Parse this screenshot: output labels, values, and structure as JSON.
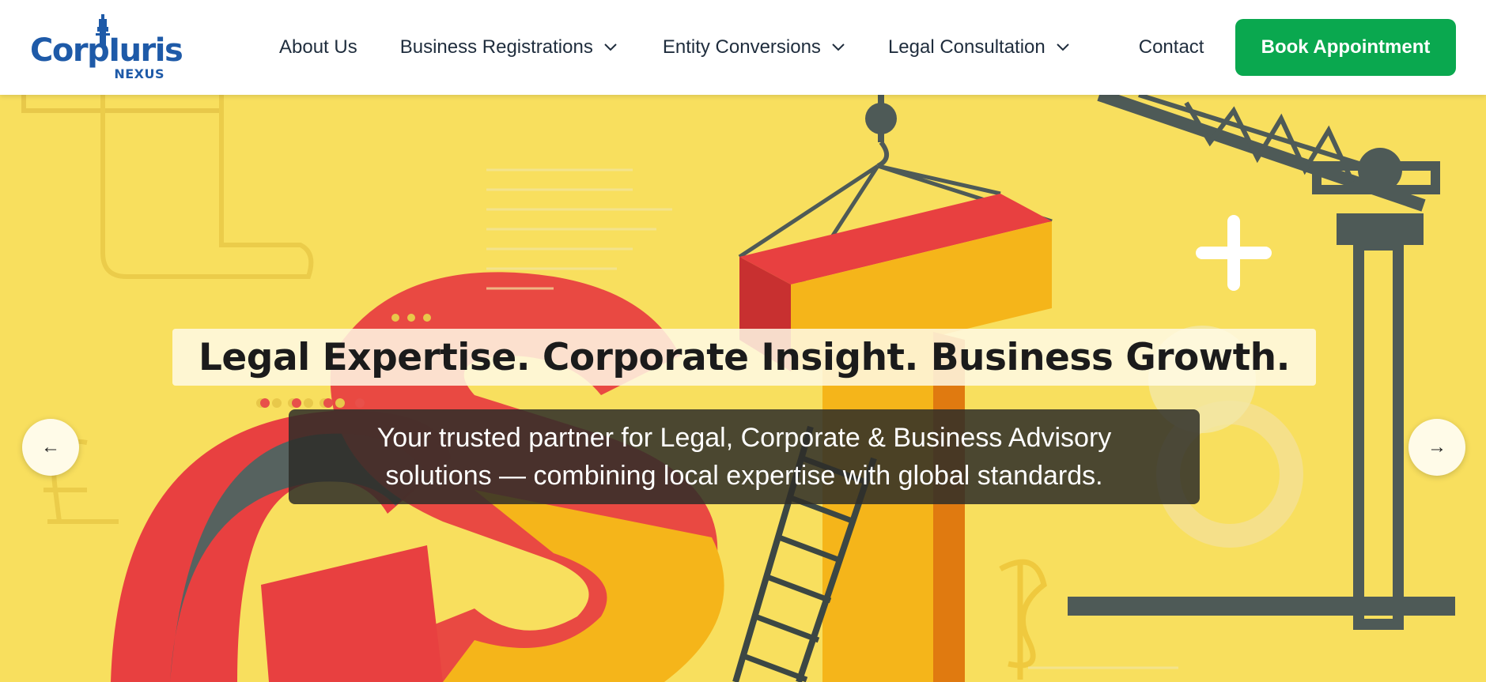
{
  "brand": {
    "logo_main": "CorpIuris",
    "logo_sub": "NEXUS",
    "primary_color": "#1e5aa8"
  },
  "nav": {
    "items": [
      {
        "label": "About Us",
        "has_dropdown": false
      },
      {
        "label": "Business Registrations",
        "has_dropdown": true
      },
      {
        "label": "Entity Conversions",
        "has_dropdown": true
      },
      {
        "label": "Legal Consultation",
        "has_dropdown": true
      },
      {
        "label": "Contact",
        "has_dropdown": false
      }
    ],
    "cta_label": "Book Appointment",
    "cta_color": "#0aa84f"
  },
  "hero": {
    "headline": "Legal Expertise. Corporate Insight. Business Growth.",
    "subtitle": "Your trusted partner for Legal, Corporate & Business Advisory solutions — combining local expertise with global standards.",
    "prev_icon": "←",
    "next_icon": "→",
    "background_color": "#f8df5e"
  }
}
